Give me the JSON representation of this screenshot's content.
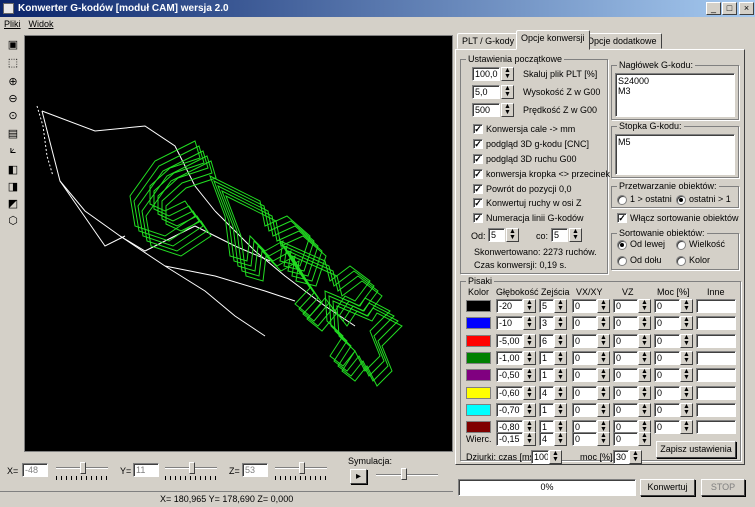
{
  "window": {
    "title": "Konwerter G-kodów [moduł CAM] wersja 2.0",
    "min": "_",
    "max": "□",
    "close": "×"
  },
  "menu": [
    "Pliki",
    "Widok"
  ],
  "tabs": [
    "PLT / G-kody",
    "Opcje konwersji",
    "Opcje dodatkowe"
  ],
  "initial": {
    "title": "Ustawienia początkowe",
    "scale_value": "100,0",
    "scale_label": "Skaluj plik PLT [%]",
    "height_value": "5,0",
    "height_label": "Wysokość Z w G00",
    "speed_value": "500",
    "speed_label": "Prędkość Z w G00",
    "checks": [
      "Konwersja cale -> mm",
      "podgląd 3D g-kodu [CNC]",
      "podgląd 3D ruchu G00",
      "konwersja kropka <> przecinek",
      "Powrót do pozycji 0,0",
      "Konwertuj ruchy w osi Z",
      "Numeracja linii G-kodów"
    ],
    "od_label": "Od:",
    "od_value": "5",
    "co_label": "co:",
    "co_value": "5",
    "converted": "Skonwertowano: 2273 ruchów.",
    "time": "Czas konwersji: 0,19 s."
  },
  "header": {
    "title": "Nagłówek G-kodu:",
    "text": "S24000\nM3"
  },
  "footer": {
    "title": "Stopka G-kodu:",
    "text": "M5"
  },
  "processing": {
    "title": "Przetwarzanie obiektów:",
    "opt1": "1 > ostatni",
    "opt2": "ostatni > 1"
  },
  "sort_enable": "Włącz sortowanie obiektów",
  "sorting": {
    "title": "Sortowanie obiektów:",
    "o1": "Od lewej",
    "o2": "Wielkość",
    "o3": "Od dołu",
    "o4": "Kolor"
  },
  "pens": {
    "title": "Pisaki",
    "headers": [
      "Kolor",
      "Głębokość",
      "Zejścia",
      "VX/XY",
      "VZ",
      "Moc [%]",
      "Inne"
    ],
    "rows": [
      {
        "color": "#000000",
        "depth": "-20",
        "passes": "5",
        "vxy": "0",
        "vz": "0",
        "power": "0"
      },
      {
        "color": "#0000ff",
        "depth": "-10",
        "passes": "3",
        "vxy": "0",
        "vz": "0",
        "power": "0"
      },
      {
        "color": "#ff0000",
        "depth": "-5,00",
        "passes": "6",
        "vxy": "0",
        "vz": "0",
        "power": "0"
      },
      {
        "color": "#008000",
        "depth": "-1,00",
        "passes": "1",
        "vxy": "0",
        "vz": "0",
        "power": "0"
      },
      {
        "color": "#800080",
        "depth": "-0,50",
        "passes": "1",
        "vxy": "0",
        "vz": "0",
        "power": "0"
      },
      {
        "color": "#ffff00",
        "depth": "-0,60",
        "passes": "4",
        "vxy": "0",
        "vz": "0",
        "power": "0"
      },
      {
        "color": "#00ffff",
        "depth": "-0,70",
        "passes": "1",
        "vxy": "0",
        "vz": "0",
        "power": "0"
      },
      {
        "color": "#800000",
        "depth": "-0,80",
        "passes": "1",
        "vxy": "0",
        "vz": "0",
        "power": "0"
      }
    ],
    "drill_label": "Wierc.",
    "drill_depth": "-0,15",
    "drill_passes": "4",
    "drill_vxy": "0",
    "drill_vz": "0",
    "dwell_label": "Dziurki: czas [ms]",
    "dwell_value": "100",
    "power_label": "moc [%]",
    "power_value": "30",
    "save": "Zapisz ustawienia"
  },
  "bottom": {
    "x_label": "X=",
    "x_val": "-48",
    "y_label": "Y=",
    "y_val": "11",
    "z_label": "Z=",
    "z_val": "53",
    "sim_label": "Symulacja:",
    "play": "▸"
  },
  "status": {
    "coords": "X= 180,965  Y= 178,690  Z=    0,000"
  },
  "progress": {
    "text": "0%",
    "value": 0
  },
  "convert": "Konwertuj",
  "stop": "STOP",
  "colors": {
    "title_start": "#0a246a",
    "title_end": "#a6caf0",
    "toolpath": "#22dd22",
    "face": "#d4d0c8"
  }
}
